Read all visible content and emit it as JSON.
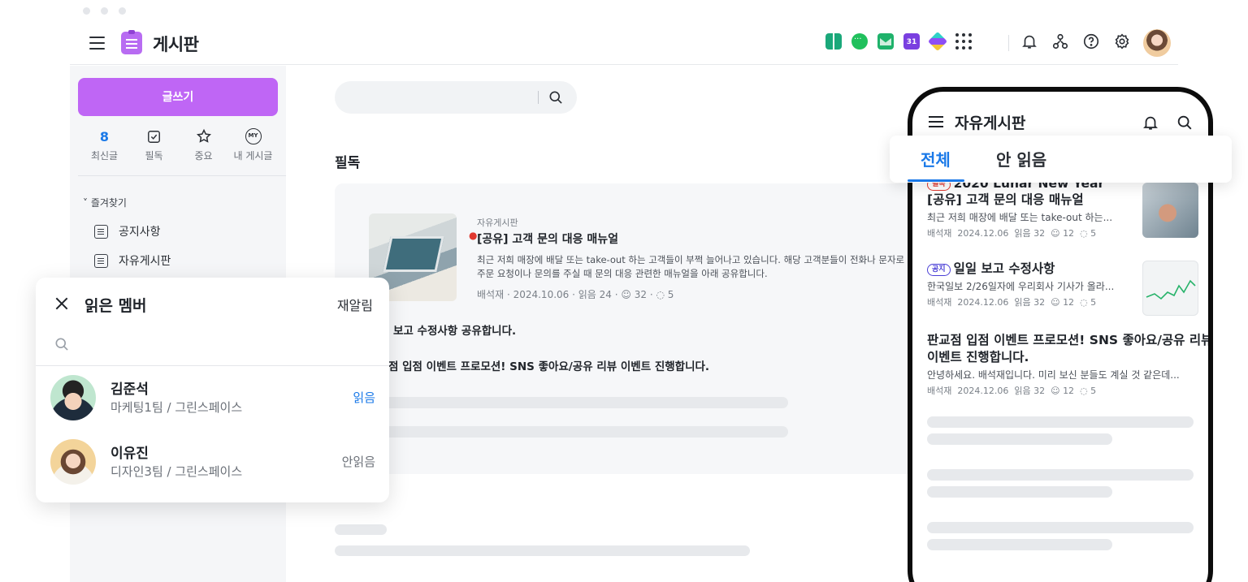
{
  "header": {
    "app_title": "게시판",
    "apps": [
      "works-icon",
      "chat-icon",
      "mail-icon",
      "calendar-icon",
      "drive-icon"
    ],
    "calendar_day": "31"
  },
  "sidebar": {
    "write_button": "글쓰기",
    "quick": [
      {
        "count": "8",
        "label": "최신글"
      },
      {
        "label": "필독"
      },
      {
        "label": "중요"
      },
      {
        "label": "내 게시글",
        "icon_text": "MY"
      }
    ],
    "favorites_title": "˅ 즐겨찾기",
    "items": [
      "공지사항",
      "자유게시판"
    ]
  },
  "main": {
    "section_title": "필독",
    "featured": {
      "board": "자유게시판",
      "title": "[공유] 고객 문의 대응 매뉴얼",
      "body_line1": "최근 저희 매장에 배달 또는 take-out 하는 고객들이 부쩍 늘어나고 있습니다. 해당 고객분들이 전화나 문자로",
      "body_line2": "주문 요청이나 문의를 주실 때 문의 대응 관련한 매뉴얼을 아래 공유합니다.",
      "author": "배석재",
      "date": "2024.10.06",
      "reads": "읽음 24",
      "reactions": "32",
      "comments": "5"
    },
    "list": [
      "보고 수정사항 공유합니다.",
      "점 입점 이벤트 프로모션! SNS 좋아요/공유 리뷰 이벤트 진행합니다."
    ]
  },
  "popup": {
    "title": "읽은 멤버",
    "remind": "재알림",
    "members": [
      {
        "name": "김준석",
        "team": "마케팅1팀 / 그린스페이스",
        "status": "읽음",
        "status_color": "#1a79e8"
      },
      {
        "name": "이유진",
        "team": "디자인3팀 / 그린스페이스",
        "status": "안읽음",
        "status_color": "#6b7078"
      }
    ]
  },
  "phone": {
    "title": "자유게시판",
    "tabs": [
      "전체",
      "안 읽음"
    ],
    "posts": [
      {
        "badge": "필독",
        "badge_color": "#e0382f",
        "title": "2020 Lunar New Year",
        "subtitle": "[공유] 고객 문의 대응 매뉴얼",
        "desc": "최근 저희 매장에 배달 또는 take-out 하는...",
        "author": "배석재",
        "date": "2024.12.06",
        "reads": "읽음 32",
        "reactions": "12",
        "comments": "5"
      },
      {
        "badge": "공지",
        "badge_color": "#4a3fd6",
        "title": "일일 보고 수정사항",
        "desc": "한국일보 2/26일자에 우리회사 기사가 올라...",
        "author": "배석재",
        "date": "2024.12.06",
        "reads": "읽음 32",
        "reactions": "12",
        "comments": "5"
      },
      {
        "title_line1": "판교점 입점 이벤트 프로모션! SNS 좋아요/공유 리뷰",
        "title_line2": "이벤트 진행합니다.",
        "desc": "안녕하세요. 배석재입니다. 미리 보신 분들도 계실 것 같은데...",
        "author": "배석재",
        "date": "2024.12.06",
        "reads": "읽음 32",
        "reactions": "12",
        "comments": "5"
      }
    ]
  }
}
